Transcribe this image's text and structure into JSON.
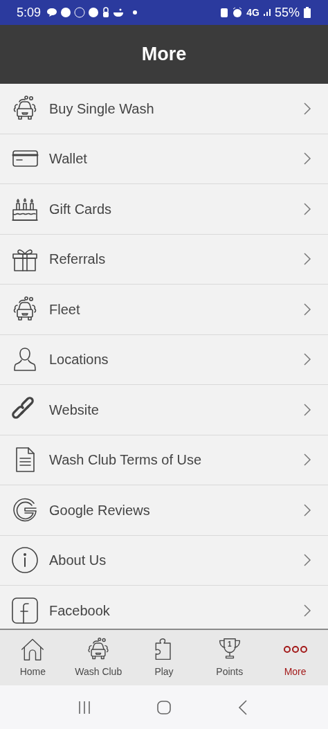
{
  "status_bar": {
    "time": "5:09",
    "network": "4G",
    "battery": "55%"
  },
  "header": {
    "title": "More"
  },
  "menu_items": [
    {
      "label": "Buy Single Wash"
    },
    {
      "label": "Wallet"
    },
    {
      "label": "Gift Cards"
    },
    {
      "label": "Referrals"
    },
    {
      "label": "Fleet"
    },
    {
      "label": "Locations"
    },
    {
      "label": "Website"
    },
    {
      "label": "Wash Club Terms of Use"
    },
    {
      "label": "Google Reviews"
    },
    {
      "label": "About Us"
    },
    {
      "label": "Facebook"
    }
  ],
  "bottom_nav": [
    {
      "label": "Home",
      "selected": false
    },
    {
      "label": "Wash Club",
      "selected": false
    },
    {
      "label": "Play",
      "selected": false
    },
    {
      "label": "Points",
      "selected": false,
      "badge": "1"
    },
    {
      "label": "More",
      "selected": true
    }
  ]
}
